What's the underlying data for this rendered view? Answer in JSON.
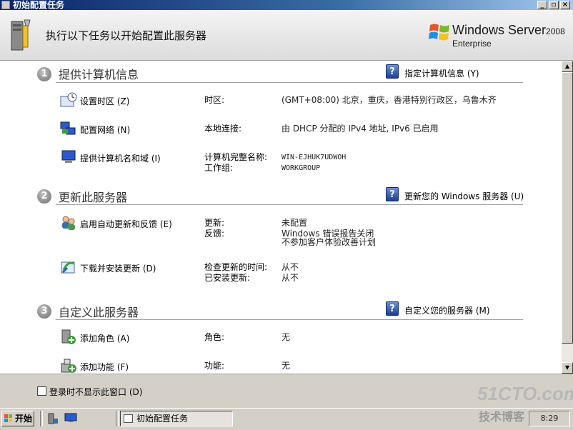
{
  "window": {
    "title": "初始配置任务"
  },
  "header": {
    "title": "执行以下任务以开始配置此服务器",
    "logo": {
      "product": "Windows Server",
      "version": "2008",
      "edition": "Enterprise"
    }
  },
  "sections": [
    {
      "number": "1",
      "title": "提供计算机信息",
      "link": "指定计算机信息 (Y)",
      "tasks": [
        {
          "label": "设置时区 (Z)",
          "icon": "clock-icon",
          "props": [
            {
              "label": "时区:",
              "value": "(GMT+08:00) 北京，重庆，香港特别行政区，乌鲁木齐"
            }
          ]
        },
        {
          "label": "配置网络 (N)",
          "icon": "network-icon",
          "props": [
            {
              "label": "本地连接:",
              "value": "由 DHCP 分配的 IPv4 地址, IPv6 已启用"
            }
          ]
        },
        {
          "label": "提供计算机名和域 (I)",
          "icon": "computer-icon",
          "props": [
            {
              "label": "计算机完整名称:",
              "value": "WIN-EJHUK7UDWOH"
            },
            {
              "label": "工作组:",
              "value": "WORKGROUP"
            }
          ]
        }
      ]
    },
    {
      "number": "2",
      "title": "更新此服务器",
      "link": "更新您的 Windows 服务器 (U)",
      "tasks": [
        {
          "label": "启用自动更新和反馈 (E)",
          "icon": "users-icon",
          "props": [
            {
              "label": "更新:",
              "value": "未配置"
            },
            {
              "label": "反馈:",
              "value": "Windows 错误报告关闭"
            },
            {
              "label": "",
              "value": "不参加客户体验改善计划"
            }
          ]
        },
        {
          "label": "下载并安装更新 (D)",
          "icon": "update-icon",
          "props": [
            {
              "label": "检查更新的时间:",
              "value": "从不"
            },
            {
              "label": "已安装更新:",
              "value": "从不"
            }
          ]
        }
      ]
    },
    {
      "number": "3",
      "title": "自定义此服务器",
      "link": "自定义您的服务器 (M)",
      "tasks": [
        {
          "label": "添加角色 (A)",
          "icon": "add-role-icon",
          "props": [
            {
              "label": "角色:",
              "value": "无"
            }
          ]
        },
        {
          "label": "添加功能 (F)",
          "icon": "add-feature-icon",
          "props": [
            {
              "label": "功能:",
              "value": "无"
            }
          ]
        }
      ]
    }
  ],
  "footer": {
    "checkbox_label": "登录时不显示此窗口 (D)",
    "checkbox_checked": false
  },
  "watermark": {
    "line1": "51CTO.com",
    "line2": "技术博客"
  },
  "taskbar": {
    "start_label": "开始",
    "active_window": "初始配置任务",
    "tray_text": "8:29"
  }
}
